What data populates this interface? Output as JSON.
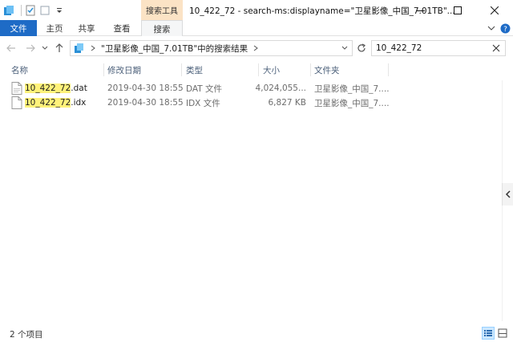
{
  "titlebar": {
    "context_tab": "搜索工具",
    "title": "10_422_72 - search-ms:displayname=\"卫星影像_中国_7.01TB\"..."
  },
  "ribbon": {
    "tabs": [
      {
        "label": "文件"
      },
      {
        "label": "主页"
      },
      {
        "label": "共享"
      },
      {
        "label": "查看"
      },
      {
        "label": "搜索"
      }
    ]
  },
  "address": {
    "path": "\"卫星影像_中国_7.01TB\"中的搜索结果"
  },
  "search": {
    "value": "10_422_72"
  },
  "columns": {
    "name": "名称",
    "modified": "修改日期",
    "type": "类型",
    "size": "大小",
    "folder": "文件夹"
  },
  "files": [
    {
      "match": "10_422_72",
      "ext": ".dat",
      "modified": "2019-04-30 18:55",
      "type": "DAT 文件",
      "size": "4,024,055...",
      "folder": "卫星影像_中国_7...."
    },
    {
      "match": "10_422_72",
      "ext": ".idx",
      "modified": "2019-04-30 18:55",
      "type": "IDX 文件",
      "size": "6,827 KB",
      "folder": "卫星影像_中国_7...."
    }
  ],
  "status": {
    "count": "2 个项目"
  },
  "colors": {
    "file_tab": "#1e6bc6",
    "context_tab": "#fbe3c5",
    "highlight": "#fff27a",
    "header_text": "#4c607a"
  }
}
